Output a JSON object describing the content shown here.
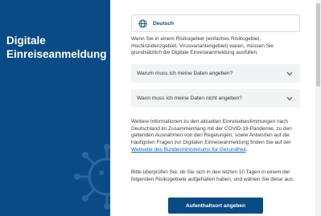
{
  "sidebar": {
    "title_line1": "Digitale",
    "title_line2": "Einreiseanmeldung",
    "background_color": "#0a4b86"
  },
  "language_select": {
    "icon": "globe-icon",
    "selected": "Deutsch"
  },
  "intro_text": "Wenn Sie in einem Risikogebiet (einfaches Risikogebiet, Hochinzidenzgebiet, Virusvariantengebiet) waren, müssen Sie grundsätzlich die Digitale Einreiseanmeldung ausfüllen.",
  "faq": [
    {
      "question": "Warum muss ich meine Daten angeben?",
      "icon": "chevron-down-icon"
    },
    {
      "question": "Wann muss ich meine Daten nicht angeben?",
      "icon": "chevron-down-icon"
    }
  ],
  "info_text": {
    "before_link": "Weitere Informationen zu den aktuellen Einreisebestimmungen nach Deutschland im Zusammenhang mit der COVID-19-Pandemie, zu den geltenden Ausnahmen von den Regelungen, sowie Antworten auf die häufigsten Fragen zur Digitalen Einreiseanmeldung finden Sie auf der ",
    "link": "Webseite des Bundesministeriums für Gesundheit",
    "after_link": "."
  },
  "check_text": "Bitte überprüfen Sie, ob Sie sich in den letzten 10 Tagen in einem der folgenden Risikogebiete aufgehalten haben, und wählen Sie diese aus.",
  "primary_button": "Aufenthaltsort angeben",
  "colors": {
    "brand": "#0a4b86",
    "link": "#0a62b8",
    "accordion_bg": "#f1f3f5"
  }
}
